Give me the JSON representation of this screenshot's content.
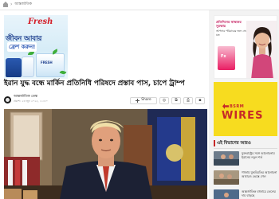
{
  "breadcrumb": {
    "section": "আন্তর্জাতিক"
  },
  "fresh_ad": {
    "brand": "Fresh",
    "line1": "জীবন আবার",
    "line2": "ফ্রেশ করুন!",
    "pack_label": "FRESH"
  },
  "article": {
    "headline": "ইরান যুদ্ধ বন্ধে মার্কিন প্রতিনিধি পরিষদে প্রস্তাব পাস, চাপে ট্রাম্প",
    "author": "আন্তর্জাতিক ডেস্ক",
    "published": "প্রকাশ: ২৩ জুন ২০২৫, ১১:৪০",
    "share_label": "Share",
    "tools": [
      {
        "name": "whatsapp-icon",
        "glyph": "◎"
      },
      {
        "name": "copy-link-icon",
        "glyph": "⧉"
      },
      {
        "name": "print-icon",
        "glyph": "⎙"
      },
      {
        "name": "comment-icon",
        "glyph": "▪"
      }
    ]
  },
  "sidebar": {
    "ad_card": {
      "title": "প্রতিদিনের স্বাস্থ্যকর সুরক্ষায়",
      "subtitle": "আপনার পরিবারের জন্য সেরা যত্ন",
      "pack_label": "Fx"
    },
    "wires_ad": {
      "brand": "BSRM",
      "title": "WIRES"
    },
    "latest": {
      "title": "এই বিভাগের আরও",
      "items": [
        {
          "text": "যুক্তরাষ্ট্রের সঙ্গে আলোচনায় ইরানের নতুন শর্ত"
        },
        {
          "text": "গাজায় যুদ্ধবিরতির আলোচনা আবারও ভেস্তে গেল"
        },
        {
          "text": "আন্তর্জাতিক বাজারে তেলের দাম বাড়ছে"
        }
      ]
    }
  }
}
